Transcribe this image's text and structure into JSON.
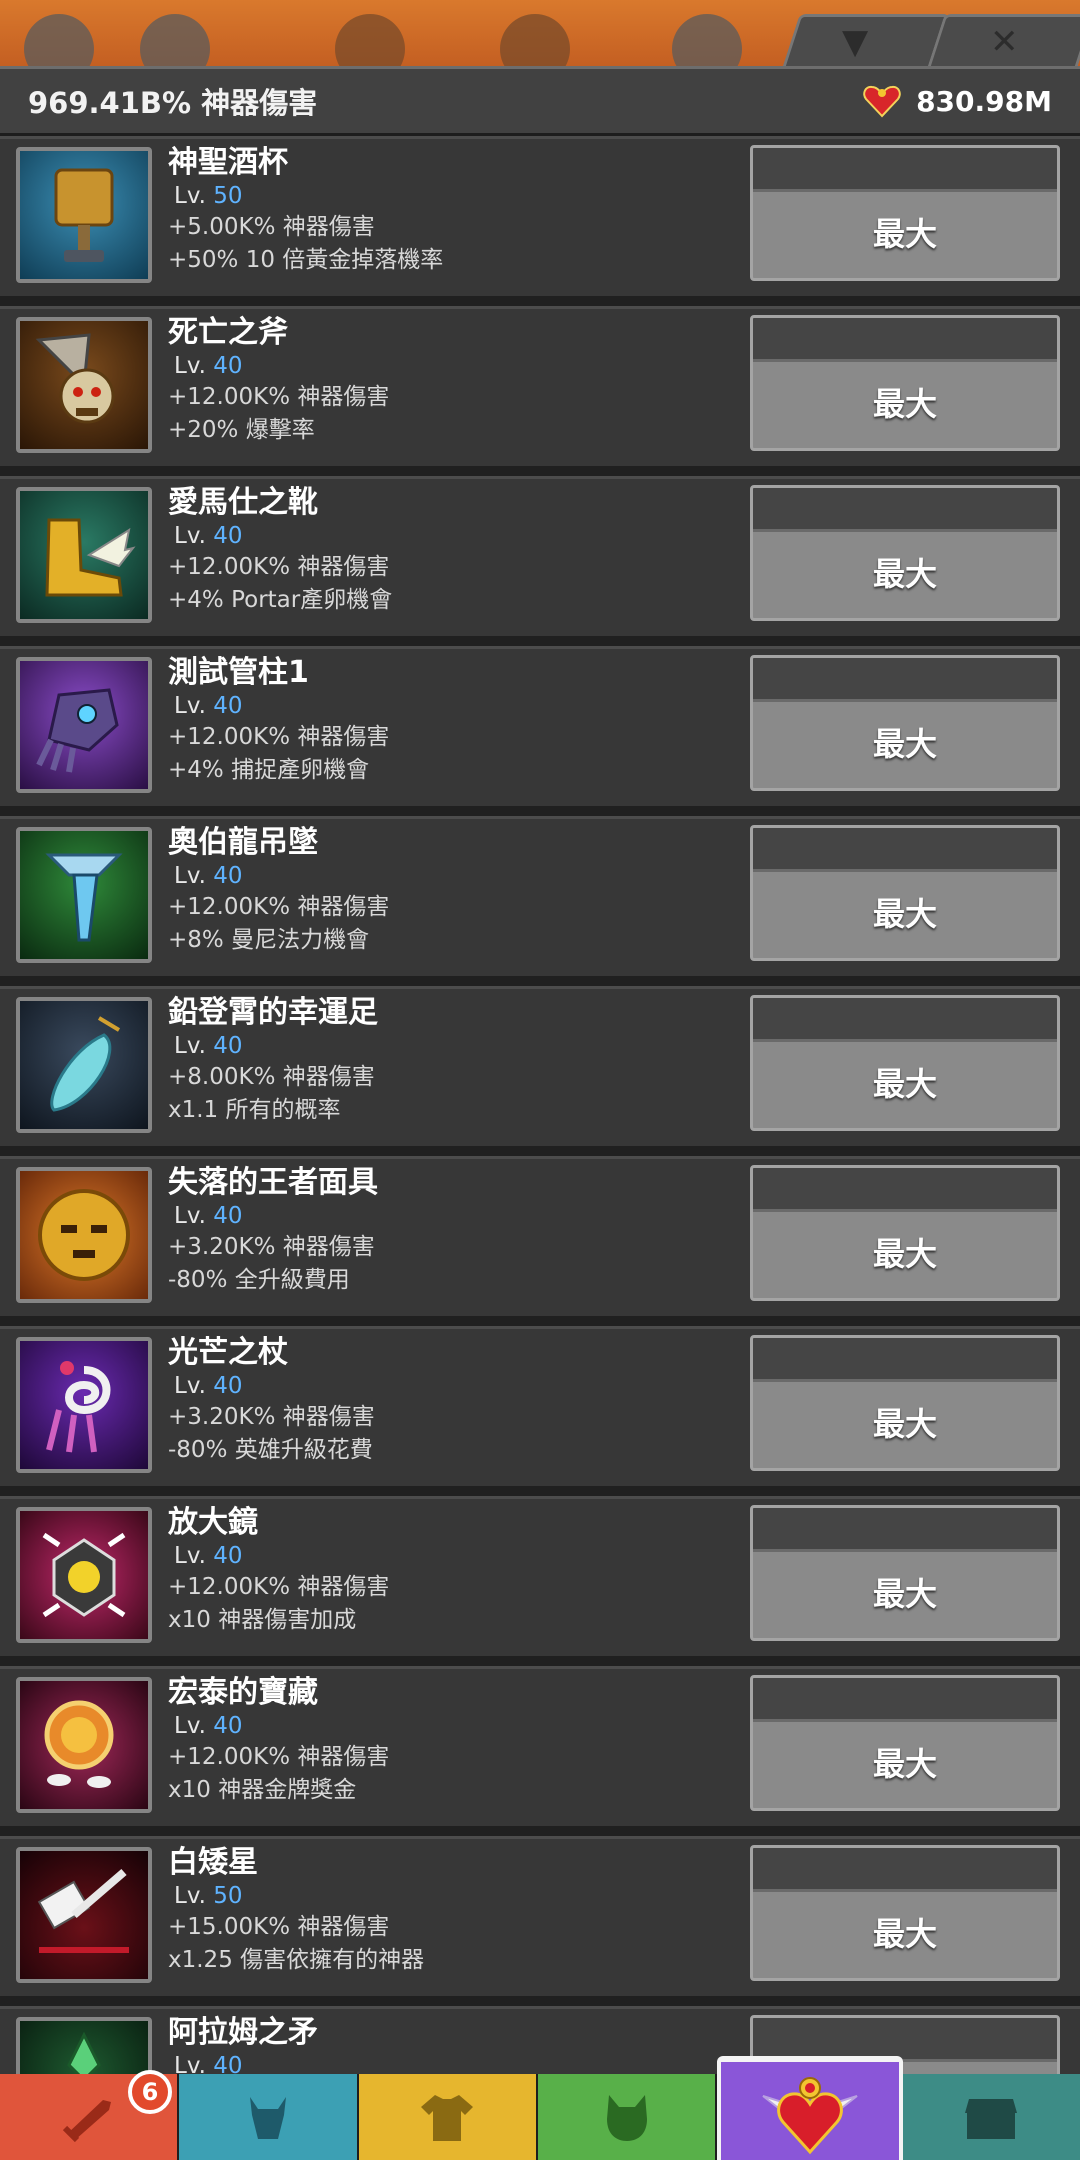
{
  "header": {
    "total_damage": "969.41B% 神器傷害",
    "currency_value": "830.98M"
  },
  "artifacts": [
    {
      "name": "神聖酒杯",
      "lv_prefix": "Lv.",
      "level": "50",
      "effect1": "+5.00K% 神器傷害",
      "effect2": "+50% 10 倍黃金掉落機率",
      "button": "最大",
      "icon": "chalice-icon",
      "bg": "#1a5570"
    },
    {
      "name": "死亡之斧",
      "lv_prefix": "Lv.",
      "level": "40",
      "effect1": "+12.00K% 神器傷害",
      "effect2": "+20% 爆擊率",
      "button": "最大",
      "icon": "axe-skull-icon",
      "bg": "#5a3312"
    },
    {
      "name": "愛馬仕之靴",
      "lv_prefix": "Lv.",
      "level": "40",
      "effect1": "+12.00K% 神器傷害",
      "effect2": "+4% Portar產卵機會",
      "button": "最大",
      "icon": "winged-boot-icon",
      "bg": "#164f44"
    },
    {
      "name": "測試管柱1",
      "lv_prefix": "Lv.",
      "level": "40",
      "effect1": "+12.00K% 神器傷害",
      "effect2": "+4% 捕捉產卵機會",
      "button": "最大",
      "icon": "gauntlet-icon",
      "bg": "#5a2a78"
    },
    {
      "name": "奧伯龍吊墜",
      "lv_prefix": "Lv.",
      "level": "40",
      "effect1": "+12.00K% 神器傷害",
      "effect2": "+8% 曼尼法力機會",
      "button": "最大",
      "icon": "pendant-icon",
      "bg": "#1f5a2a"
    },
    {
      "name": "鉛登霄的幸運足",
      "lv_prefix": "Lv.",
      "level": "40",
      "effect1": "+8.00K% 神器傷害",
      "effect2": "x1.1 所有的概率",
      "button": "最大",
      "icon": "lucky-foot-icon",
      "bg": "#1d2a3a"
    },
    {
      "name": "失落的王者面具",
      "lv_prefix": "Lv.",
      "level": "40",
      "effect1": "+3.20K% 神器傷害",
      "effect2": "-80% 全升級費用",
      "button": "最大",
      "icon": "golden-mask-icon",
      "bg": "#a8461c"
    },
    {
      "name": "光芒之杖",
      "lv_prefix": "Lv.",
      "level": "40",
      "effect1": "+3.20K% 神器傷害",
      "effect2": "-80% 英雄升級花費",
      "button": "最大",
      "icon": "staff-icon",
      "bg": "#3b1660"
    },
    {
      "name": "放大鏡",
      "lv_prefix": "Lv.",
      "level": "40",
      "effect1": "+12.00K% 神器傷害",
      "effect2": "x10 神器傷害加成",
      "button": "最大",
      "icon": "magnifier-icon",
      "bg": "#7a1840"
    },
    {
      "name": "宏泰的寶藏",
      "lv_prefix": "Lv.",
      "level": "40",
      "effect1": "+12.00K% 神器傷害",
      "effect2": "x10 神器金牌獎金",
      "button": "最大",
      "icon": "treasure-coin-icon",
      "bg": "#6a1e38"
    },
    {
      "name": "白矮星",
      "lv_prefix": "Lv.",
      "level": "50",
      "effect1": "+15.00K% 神器傷害",
      "effect2": "x1.25 傷害依擁有的神器",
      "button": "最大",
      "icon": "white-hammer-icon",
      "bg": "#3a0a12"
    },
    {
      "name": "阿拉姆之矛",
      "lv_prefix": "Lv.",
      "level": "40",
      "effect1": "",
      "effect2": "",
      "button": "",
      "icon": "spear-icon",
      "bg": "#0f3a1a"
    }
  ],
  "tabs": [
    {
      "name": "sword-tab",
      "icon": "sword-icon",
      "badge": "6"
    },
    {
      "name": "heroes-tab",
      "icon": "helmet-icon"
    },
    {
      "name": "equipment-tab",
      "icon": "shirt-icon"
    },
    {
      "name": "pets-tab",
      "icon": "pet-icon"
    },
    {
      "name": "artifacts-tab",
      "icon": "winged-heart-icon",
      "active": true
    },
    {
      "name": "shop-tab",
      "icon": "chest-icon"
    }
  ]
}
